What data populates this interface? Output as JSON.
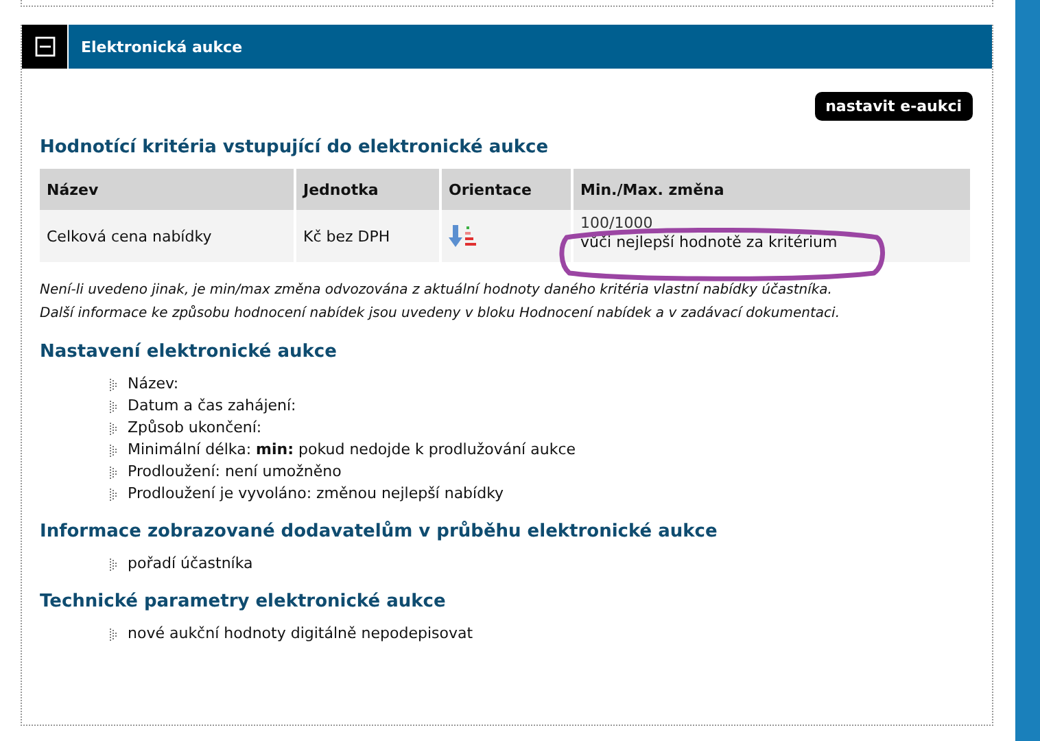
{
  "panel": {
    "title": "Elektronická aukce",
    "expanded": true
  },
  "action_button": "nastavit e-aukci",
  "criteria": {
    "heading": "Hodnotící kritéria vstupující do elektronické aukce",
    "columns": [
      "Název",
      "Jednotka",
      "Orientace",
      "Min./Max. změna"
    ],
    "rows": [
      {
        "name": "Celková cena nabídky",
        "unit": "Kč bez DPH",
        "change_value": "100/1000",
        "change_basis": "vůči nejlepší hodnotě za kritérium",
        "highlighted": true
      }
    ]
  },
  "note": [
    "Není-li uvedeno jinak, je min/max změna odvozována z aktuální hodnoty daného kritéria vlastní nabídky účastníka.",
    "Další informace ke způsobu hodnocení nabídek jsou uvedeny v bloku Hodnocení nabídek a v zadávací dokumentaci."
  ],
  "sections": [
    {
      "heading": "Nastavení elektronické aukce",
      "items": [
        "Název:",
        "Datum a čas zahájení:",
        "Způsob ukončení:",
        "Minimální délka: **min:** pokud nedojde k prodlužování aukce",
        "Prodloužení: není umožněno",
        "Prodloužení je vyvoláno: změnou nejlepší nabídky"
      ]
    },
    {
      "heading": "Informace zobrazované dodavatelům v průběhu elektronické aukce",
      "items": [
        "pořadí účastníka"
      ]
    },
    {
      "heading": "Technické parametry elektronické aukce",
      "items": [
        "nové aukční hodnoty digitálně nepodepisovat"
      ]
    }
  ]
}
